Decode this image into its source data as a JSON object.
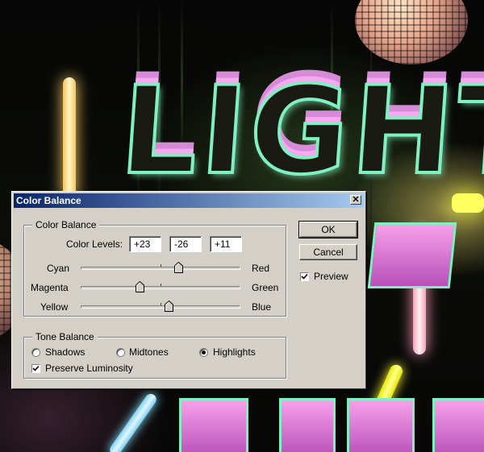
{
  "dialog": {
    "title": "Color Balance",
    "close_symbol": "✕",
    "color_balance_group": {
      "legend": "Color Balance",
      "levels_label": "Color Levels:",
      "levels": [
        "+23",
        "-26",
        "+11"
      ],
      "sliders": [
        {
          "left": "Cyan",
          "right": "Red",
          "value": 23
        },
        {
          "left": "Magenta",
          "right": "Green",
          "value": -26
        },
        {
          "left": "Yellow",
          "right": "Blue",
          "value": 11
        }
      ],
      "slider_min": -100,
      "slider_max": 100
    },
    "tone_balance_group": {
      "legend": "Tone Balance",
      "options": [
        {
          "label": "Shadows",
          "selected": false
        },
        {
          "label": "Midtones",
          "selected": false
        },
        {
          "label": "Highlights",
          "selected": true
        }
      ],
      "preserve_luminosity": {
        "label": "Preserve Luminosity",
        "checked": true
      }
    },
    "buttons": {
      "ok": "OK",
      "cancel": "Cancel"
    },
    "preview": {
      "label": "Preview",
      "checked": true
    }
  },
  "colors": {
    "title_bar_start": "#0a246a",
    "title_bar_end": "#a6caf0",
    "dialog_face": "#d4d0c8"
  },
  "background": {
    "letters": "LIGHT"
  }
}
